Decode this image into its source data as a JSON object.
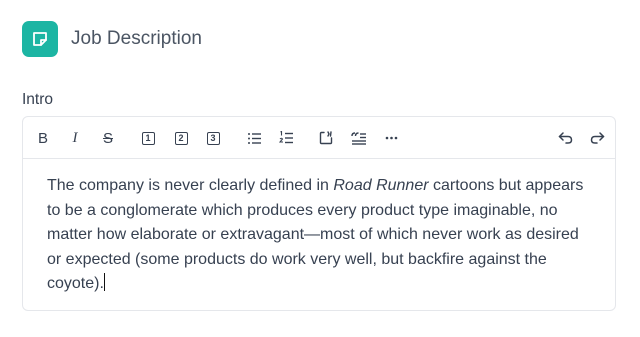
{
  "header": {
    "title": "Job Description",
    "icon": "note-icon",
    "accent": "#1cb5a3"
  },
  "field": {
    "label": "Intro"
  },
  "toolbar": {
    "buttons": [
      {
        "name": "bold",
        "glyph": "B"
      },
      {
        "name": "italic",
        "glyph": "I"
      },
      {
        "name": "strikethrough",
        "glyph": "S"
      },
      {
        "name": "heading-1",
        "glyph": "1"
      },
      {
        "name": "heading-2",
        "glyph": "2"
      },
      {
        "name": "heading-3",
        "glyph": "3"
      },
      {
        "name": "bullet-list"
      },
      {
        "name": "ordered-list"
      },
      {
        "name": "code-block"
      },
      {
        "name": "blockquote"
      },
      {
        "name": "more"
      },
      {
        "name": "undo"
      },
      {
        "name": "redo"
      }
    ]
  },
  "content": {
    "text_before": "The company is never clearly defined in ",
    "text_italic": "Road Runner",
    "text_after": " cartoons but appears to be a conglomerate which produces every product type imaginable, no matter how elaborate or extravagant—most of which never work as desired or expected (some products do work very well, but backfire against the coyote)."
  }
}
